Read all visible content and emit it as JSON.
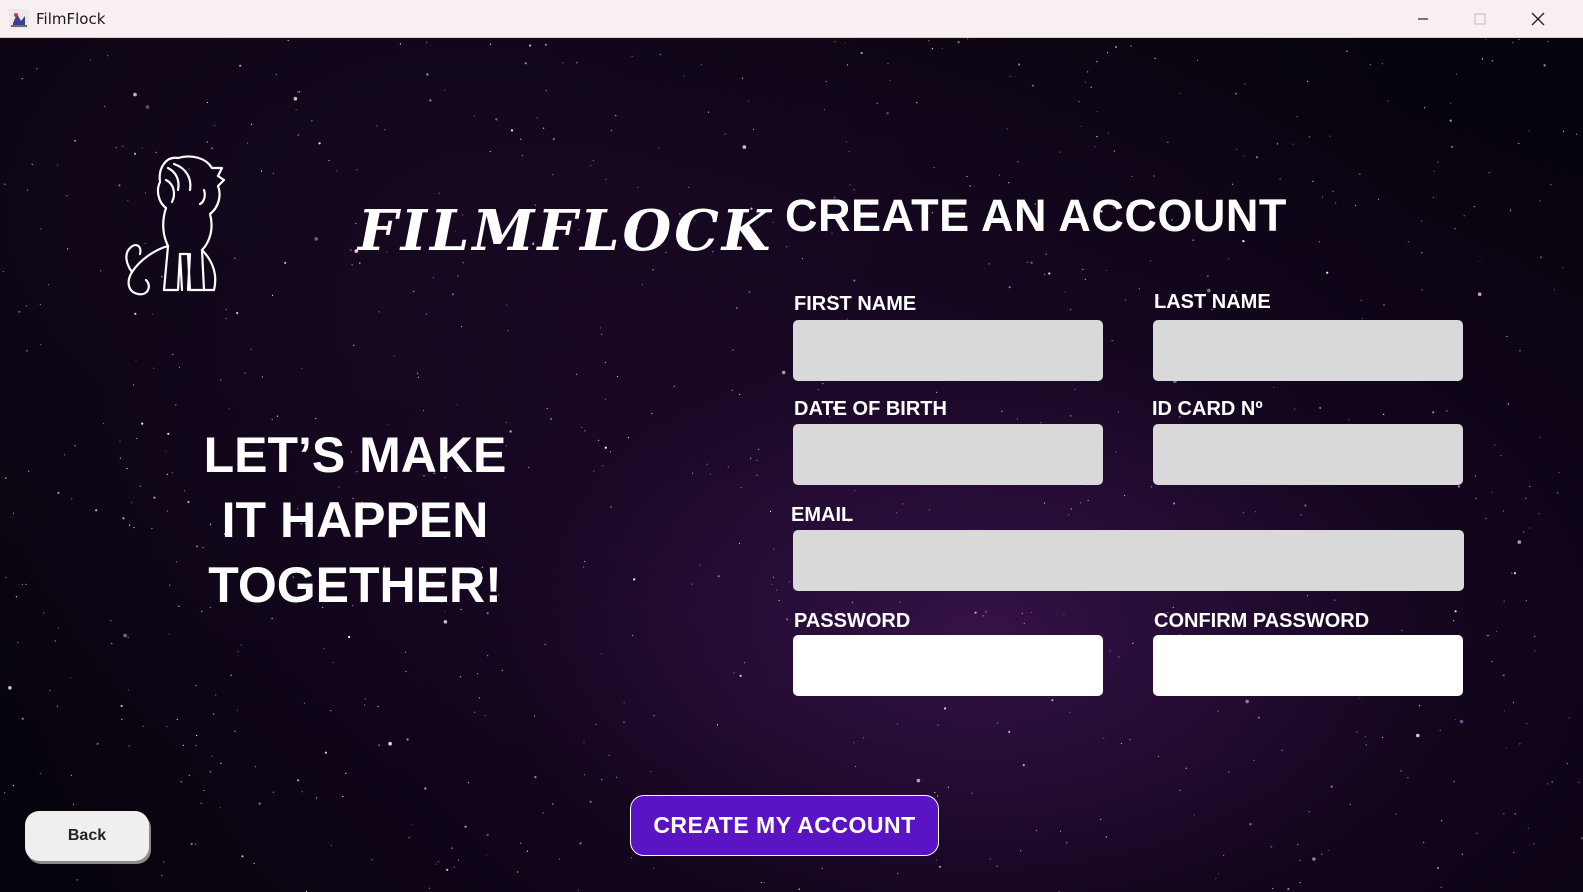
{
  "window": {
    "title": "FilmFlock"
  },
  "logo": {
    "text": "FILMFLOCK",
    "icon": "lion-icon"
  },
  "tagline": {
    "line1": "LET’S MAKE",
    "line2": "IT HAPPEN",
    "line3": "TOGETHER!"
  },
  "form": {
    "title": "CREATE AN ACCOUNT",
    "first_name": {
      "label": "FIRST NAME",
      "value": ""
    },
    "last_name": {
      "label": "LAST NAME",
      "value": ""
    },
    "date_of_birth": {
      "label": "DATE OF BIRTH",
      "value": ""
    },
    "id_card": {
      "label": "ID CARD Nº",
      "value": ""
    },
    "email": {
      "label": "EMAIL",
      "value": ""
    },
    "password": {
      "label": "PASSWORD",
      "value": ""
    },
    "confirm_password": {
      "label": "CONFIRM PASSWORD",
      "value": ""
    }
  },
  "buttons": {
    "create": "CREATE MY ACCOUNT",
    "back": "Back"
  },
  "colors": {
    "accent": "#5a14c4",
    "field_gray": "#d9d9d9",
    "field_white": "#ffffff",
    "background": "#07030c",
    "titlebar": "#f8f0f0"
  }
}
